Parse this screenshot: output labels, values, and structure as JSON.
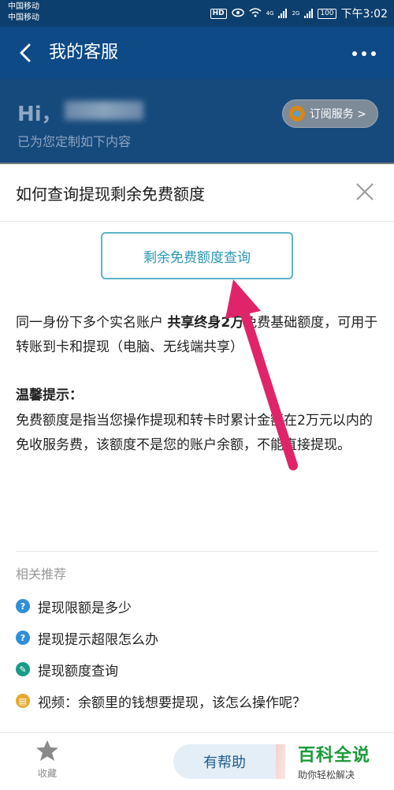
{
  "status_bar": {
    "carrier_1": "中国移动",
    "carrier_2": "中国移动",
    "network": "HD",
    "signal_1": "4G",
    "signal_2": "2G",
    "battery": "100",
    "time": "下午3:02"
  },
  "nav": {
    "title": "我的客服"
  },
  "greeting": {
    "hi": "Hi，",
    "subtitle": "已为您定制如下内容",
    "subscribe_label": "订阅服务 >"
  },
  "card": {
    "title": "如何查询提现剩余免费额度",
    "query_button": "剩余免费额度查询",
    "para_1": "同一身份下多个实名账户 ",
    "para_bold": "共享终身2万",
    "para_2": "免费基础额度，可用于转账到卡和提现（电脑、无线端共享）",
    "tip_title": "温馨提示：",
    "tip_text": "免费额度是指当您操作提现和转卡时累计金额在2万元以内的免收服务费，该额度不是您的账户余额，不能直接提现。"
  },
  "recommendations": {
    "title": "相关推荐",
    "items": [
      {
        "label": "提现限额是多少",
        "icon": "question-icon",
        "color": "#2f8fd8",
        "glyph": "?"
      },
      {
        "label": "提现提示超限怎么办",
        "icon": "question-icon",
        "color": "#2f8fd8",
        "glyph": "?"
      },
      {
        "label": "提现额度查询",
        "icon": "wrench-icon",
        "color": "#1b9a8a",
        "glyph": "✎"
      },
      {
        "label": "视频：余额里的钱想要提现，该怎么操作呢？",
        "icon": "video-icon",
        "color": "#e4a92d",
        "glyph": "▤"
      }
    ]
  },
  "bottom_bar": {
    "favorite_label": "收藏",
    "help_label": "有帮助",
    "watermark_main": "百科全说",
    "watermark_sub": "助你轻松解决"
  },
  "colors": {
    "nav_bg": "#0d4a86",
    "accent": "#2a97b6",
    "annotation_arrow": "#e0246a"
  }
}
